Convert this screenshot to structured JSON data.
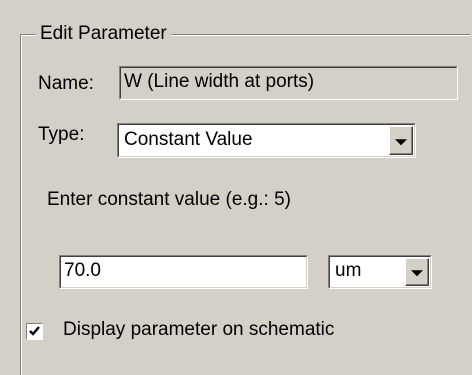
{
  "group": {
    "title": "Edit Parameter"
  },
  "name": {
    "label": "Name:",
    "value": "W (Line width at ports)"
  },
  "type": {
    "label": "Type:",
    "selected": "Constant Value"
  },
  "constant": {
    "prompt": "Enter constant value (e.g.: 5)",
    "value": "70.0"
  },
  "unit": {
    "selected": "um"
  },
  "display_checkbox": {
    "label": "Display parameter on schematic",
    "checked": true
  },
  "icons": {
    "dropdown": "chevron-down-icon",
    "check": "checkmark-icon"
  }
}
